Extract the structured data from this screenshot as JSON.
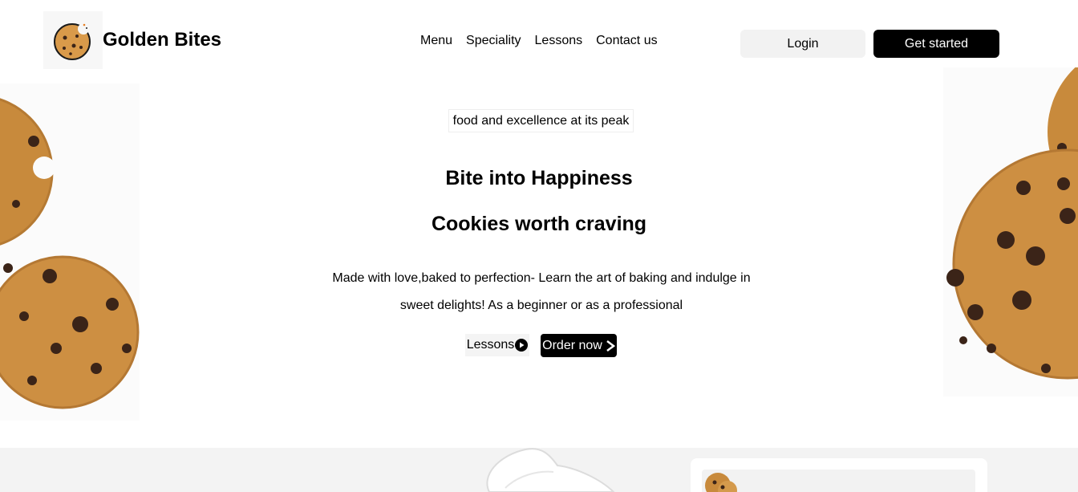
{
  "header": {
    "brand": "Golden Bites",
    "nav": [
      "Menu",
      "Speciality",
      "Lessons",
      "Contact us"
    ],
    "login_label": "Login",
    "get_started_label": "Get started"
  },
  "hero": {
    "tagline": "food and excellence at its peak",
    "title_line1": "Bite into Happiness",
    "title_line2": "Cookies worth craving",
    "description_line1": "Made with love,baked to perfection- Learn the art of baking and indulge in",
    "description_line2": "sweet delights! As a beginner or as a professional",
    "lessons_label": "Lessons",
    "order_label": "Order now"
  },
  "colors": {
    "primary": "#000000",
    "cookie": "#c98a3e",
    "chip": "#3b2418",
    "surface": "#f3f3f3"
  }
}
